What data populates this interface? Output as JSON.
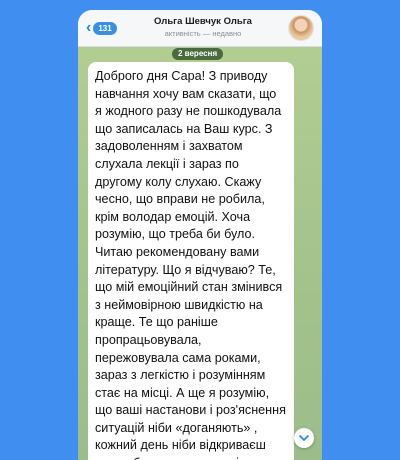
{
  "header": {
    "back_badge": "131",
    "title": "Ольга Шевчук Ольга",
    "subtitle": "активність — недавно"
  },
  "chat": {
    "date": "2 вересня",
    "message_lines": "Доброго дня Сара! З приводу\nнавчання хочу вам сказати, що\nя жодного разу не пошкодувала\nщо записалась на Ваш курс. З\nзадоволенням і захватом\nслухала лекції і зараз по\nдругому колу слухаю. Скажу\nчесно, що вправи не робила,\nкрім володар емоцій. Хоча\nрозумію, що треба би було.\nЧитаю рекомендовану вами\nлітературу. Що я відчуваю? Те,\nщо мій емоційний стан змінився\nз неймовірною швидкістю на\nкраще. Те що раніше\nпропрацьовувала,\nпережовувала сама роками,\nзараз з легкістю і розумінням\nстає на місці. А ще я розумію,\nщо ваші настанови і роз'яснення\nситуацій ніби «доганяють» ,\nкожний день ніби відкриваєш\nдля себе щось нове, по іншому"
  },
  "icons": {
    "back": "chevron-left-icon",
    "scroll_down": "chevron-down-icon"
  },
  "colors": {
    "page_bg": "#3f8ef0",
    "accent": "#2c87d7",
    "chat_bg": "#a8c691",
    "date_pill": "#486a3d"
  }
}
